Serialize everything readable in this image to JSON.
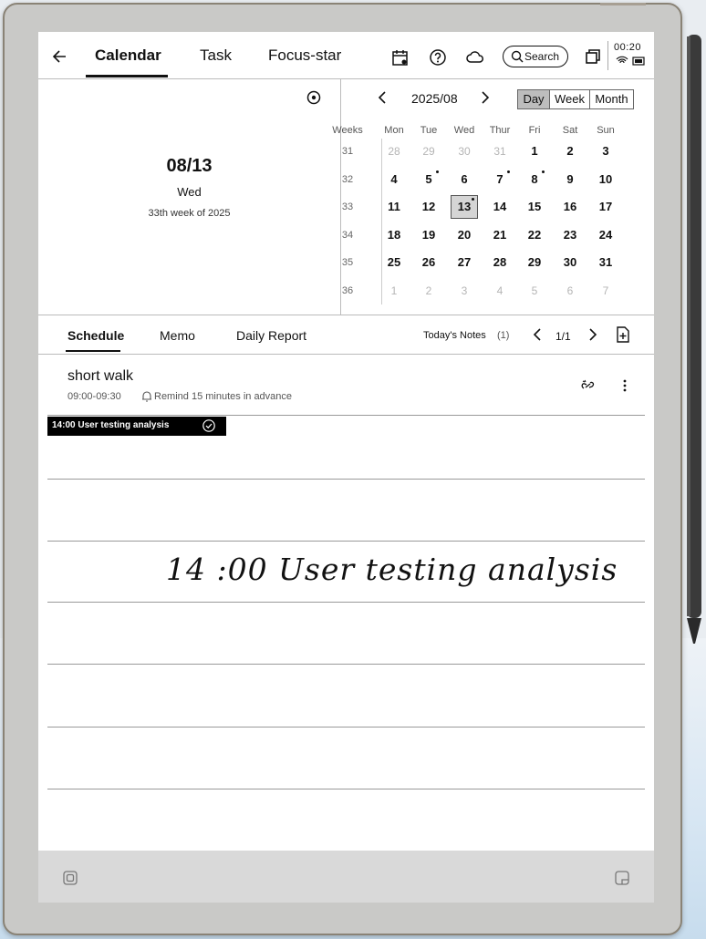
{
  "topbar": {
    "tabs": [
      "Calendar",
      "Task",
      "Focus-star"
    ],
    "search_label": "Search",
    "clock": "00:20"
  },
  "date_panel": {
    "date": "08/13",
    "weekday": "Wed",
    "week_text": "33th week of 2025"
  },
  "calendar": {
    "month_label": "2025/08",
    "views": [
      "Day",
      "Week",
      "Month"
    ],
    "active_view": "Day",
    "week_header": "Weeks",
    "day_headers": [
      "Mon",
      "Tue",
      "Wed",
      "Thur",
      "Fri",
      "Sat",
      "Sun"
    ],
    "rows": [
      {
        "week": "31",
        "days": [
          "28",
          "29",
          "30",
          "31",
          "1",
          "2",
          "3"
        ],
        "muted": [
          true,
          true,
          true,
          true,
          false,
          false,
          false
        ]
      },
      {
        "week": "32",
        "days": [
          "4",
          "5",
          "6",
          "7",
          "8",
          "9",
          "10"
        ],
        "muted": [
          false,
          false,
          false,
          false,
          false,
          false,
          false
        ]
      },
      {
        "week": "33",
        "days": [
          "11",
          "12",
          "13",
          "14",
          "15",
          "16",
          "17"
        ],
        "muted": [
          false,
          false,
          false,
          false,
          false,
          false,
          false
        ]
      },
      {
        "week": "34",
        "days": [
          "18",
          "19",
          "20",
          "21",
          "22",
          "23",
          "24"
        ],
        "muted": [
          false,
          false,
          false,
          false,
          false,
          false,
          false
        ]
      },
      {
        "week": "35",
        "days": [
          "25",
          "26",
          "27",
          "28",
          "29",
          "30",
          "31"
        ],
        "muted": [
          false,
          false,
          false,
          false,
          false,
          false,
          false
        ]
      },
      {
        "week": "36",
        "days": [
          "1",
          "2",
          "3",
          "4",
          "5",
          "6",
          "7"
        ],
        "muted": [
          true,
          true,
          true,
          true,
          true,
          true,
          true
        ]
      }
    ],
    "selected_day": "13"
  },
  "subtabs": {
    "items": [
      "Schedule",
      "Memo",
      "Daily Report"
    ],
    "notes_label": "Today's Notes",
    "notes_count": "(1)",
    "page": "1/1"
  },
  "schedule": {
    "title": "short walk",
    "time": "09:00-09:30",
    "reminder": "Remind 15 minutes in advance",
    "tag": "14:00 User testing analysis"
  },
  "handwriting": "14 :00   User   testing   analysis"
}
